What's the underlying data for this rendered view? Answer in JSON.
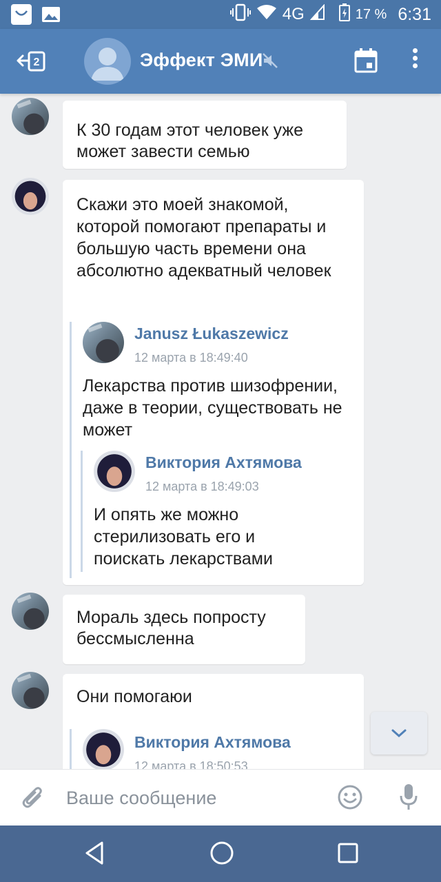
{
  "status_bar": {
    "network": "4G",
    "battery": "17 %",
    "time": "6:31",
    "icons": [
      "store-icon",
      "gallery-icon",
      "vibrate-icon",
      "wifi-icon",
      "signal-icon",
      "battery-icon"
    ]
  },
  "header": {
    "title": "Эффект ЭМИ",
    "icons": [
      "back-chats-icon",
      "avatar-placeholder-icon",
      "muted-icon",
      "calendar-icon",
      "more-vertical-icon"
    ]
  },
  "messages": [
    {
      "text": "К 30 годам этот человек уже может завести семью"
    },
    {
      "text": "Скажи это моей знакомой, которой помогают препараты и большую часть времени она абсолютно адекватный человек",
      "quote": {
        "author": "Janusz Łukaszewicz",
        "time": "12 марта в 18:49:40",
        "text": "Лекарства против шизофрении, даже в теории, существовать не может",
        "quote": {
          "author": "Виктория Ахтямова",
          "time": "12 марта в 18:49:03",
          "text": "И опять же можно стерилизовать его и поискать лекарствами"
        }
      }
    },
    {
      "text": "Мораль здесь попросту бессмысленна"
    },
    {
      "text": "Они помогаюи",
      "quote": {
        "author": "Виктория Ахтямова",
        "time": "12 марта в 18:50:53"
      }
    }
  ],
  "composer": {
    "placeholder": "Ваше сообщение",
    "icons": [
      "attach-icon",
      "emoji-icon",
      "mic-icon"
    ]
  },
  "nav_bar": {
    "icons": [
      "back-triangle-icon",
      "home-circle-icon",
      "recents-square-icon"
    ]
  },
  "colors": {
    "header": "#5181b8",
    "status_bar": "#4a76a8",
    "nav_bar": "#4a6892",
    "background": "#edeef0",
    "link": "#4f79a8"
  }
}
